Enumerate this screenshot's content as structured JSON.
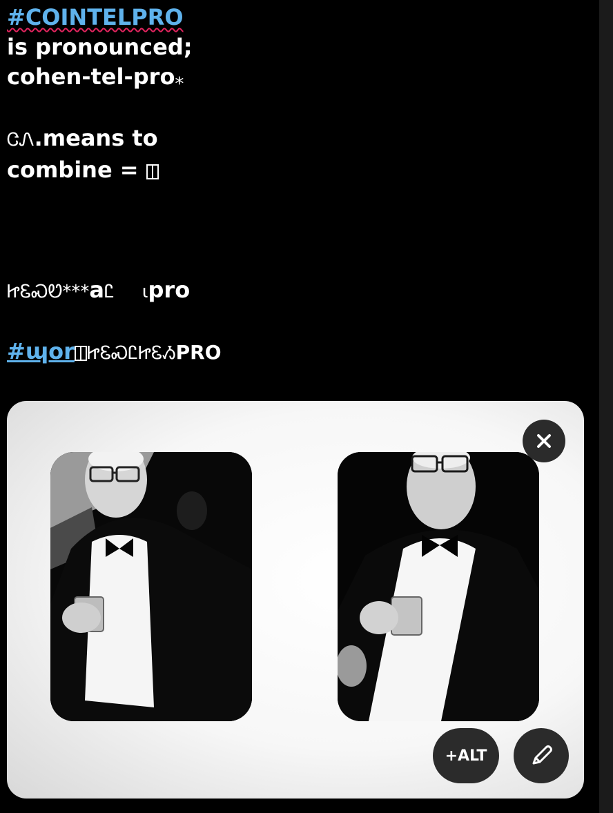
{
  "post": {
    "hashtag1": "#COINTELPRO",
    "line2": "is pronounced;",
    "line3": "cohen-tel-pro",
    "line3_suffix": "⁎",
    "line4_glyph": "ᏣᏁ",
    "line4_text": ".means to",
    "line5": "combine =",
    "line6_glyph": "ᏥᏋᏍᏬ***",
    "line6_mid": "a",
    "line6_glyph2": "Ꮭ",
    "line6_gap_glyph": "ɩ",
    "line6_end": "pro",
    "hashtag2": "#ɰor",
    "line7_glyph": "ᏥᏋᏍᏝᏥᏋᏱ",
    "line7_end": "PRO"
  },
  "media": {
    "remove_icon": "close-icon",
    "alt_label": "+ALT",
    "edit_icon": "pencil-icon"
  },
  "colors": {
    "hashtag": "#5fb2ec",
    "spellcheck": "#e0245e",
    "button_bg": "#2b2b2b"
  }
}
